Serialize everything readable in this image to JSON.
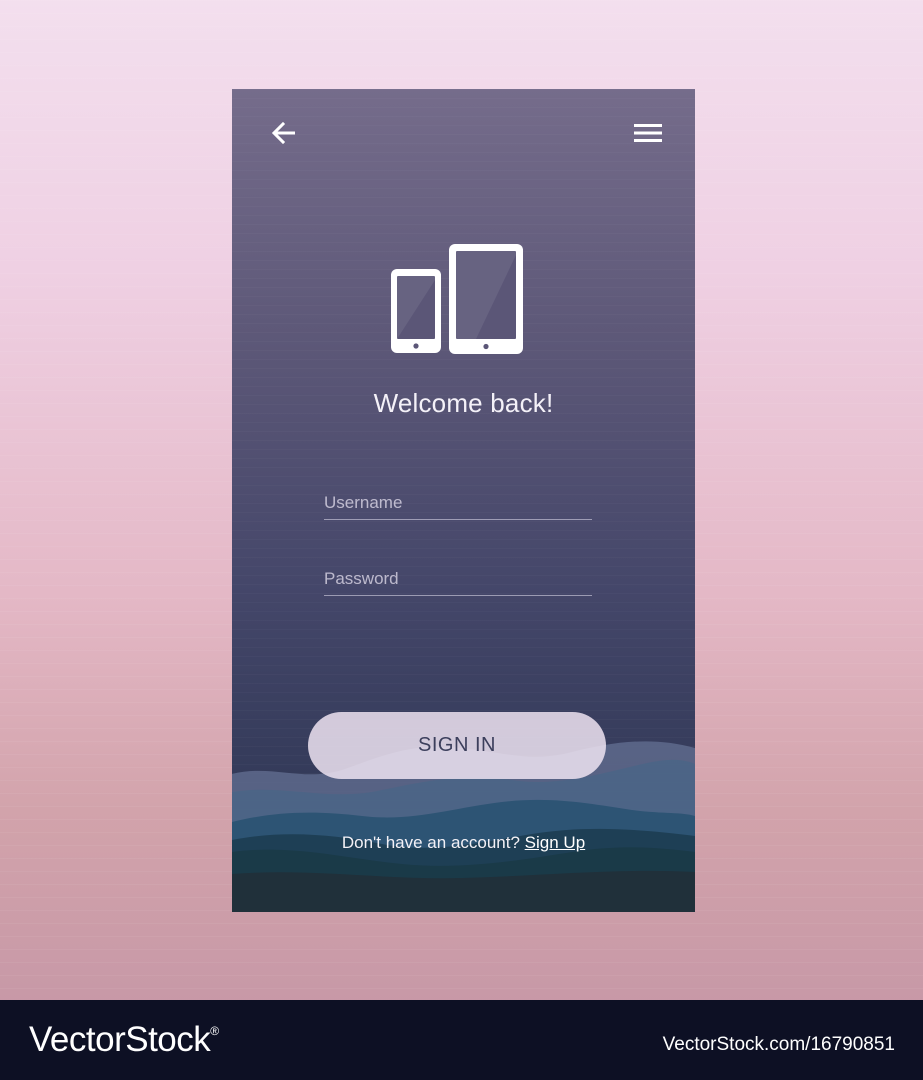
{
  "screen": {
    "title": "Welcome back!",
    "icons": {
      "back": "back-arrow-icon",
      "menu": "hamburger-menu-icon",
      "devices": "phone-and-tablet-icon"
    }
  },
  "form": {
    "username_placeholder": "Username",
    "password_placeholder": "Password",
    "submit_label": "SIGN IN"
  },
  "signup": {
    "prompt": "Don't have an account?",
    "link_label": "Sign Up"
  },
  "watermark": {
    "brand": "VectorStock",
    "registered_mark": "®",
    "image_id": "VectorStock.com/16790851"
  },
  "colors": {
    "screen_top": "#756c8b",
    "screen_bottom": "#2c3652",
    "button_fill": "#ece2f0",
    "footer_bg": "#0d1024"
  }
}
